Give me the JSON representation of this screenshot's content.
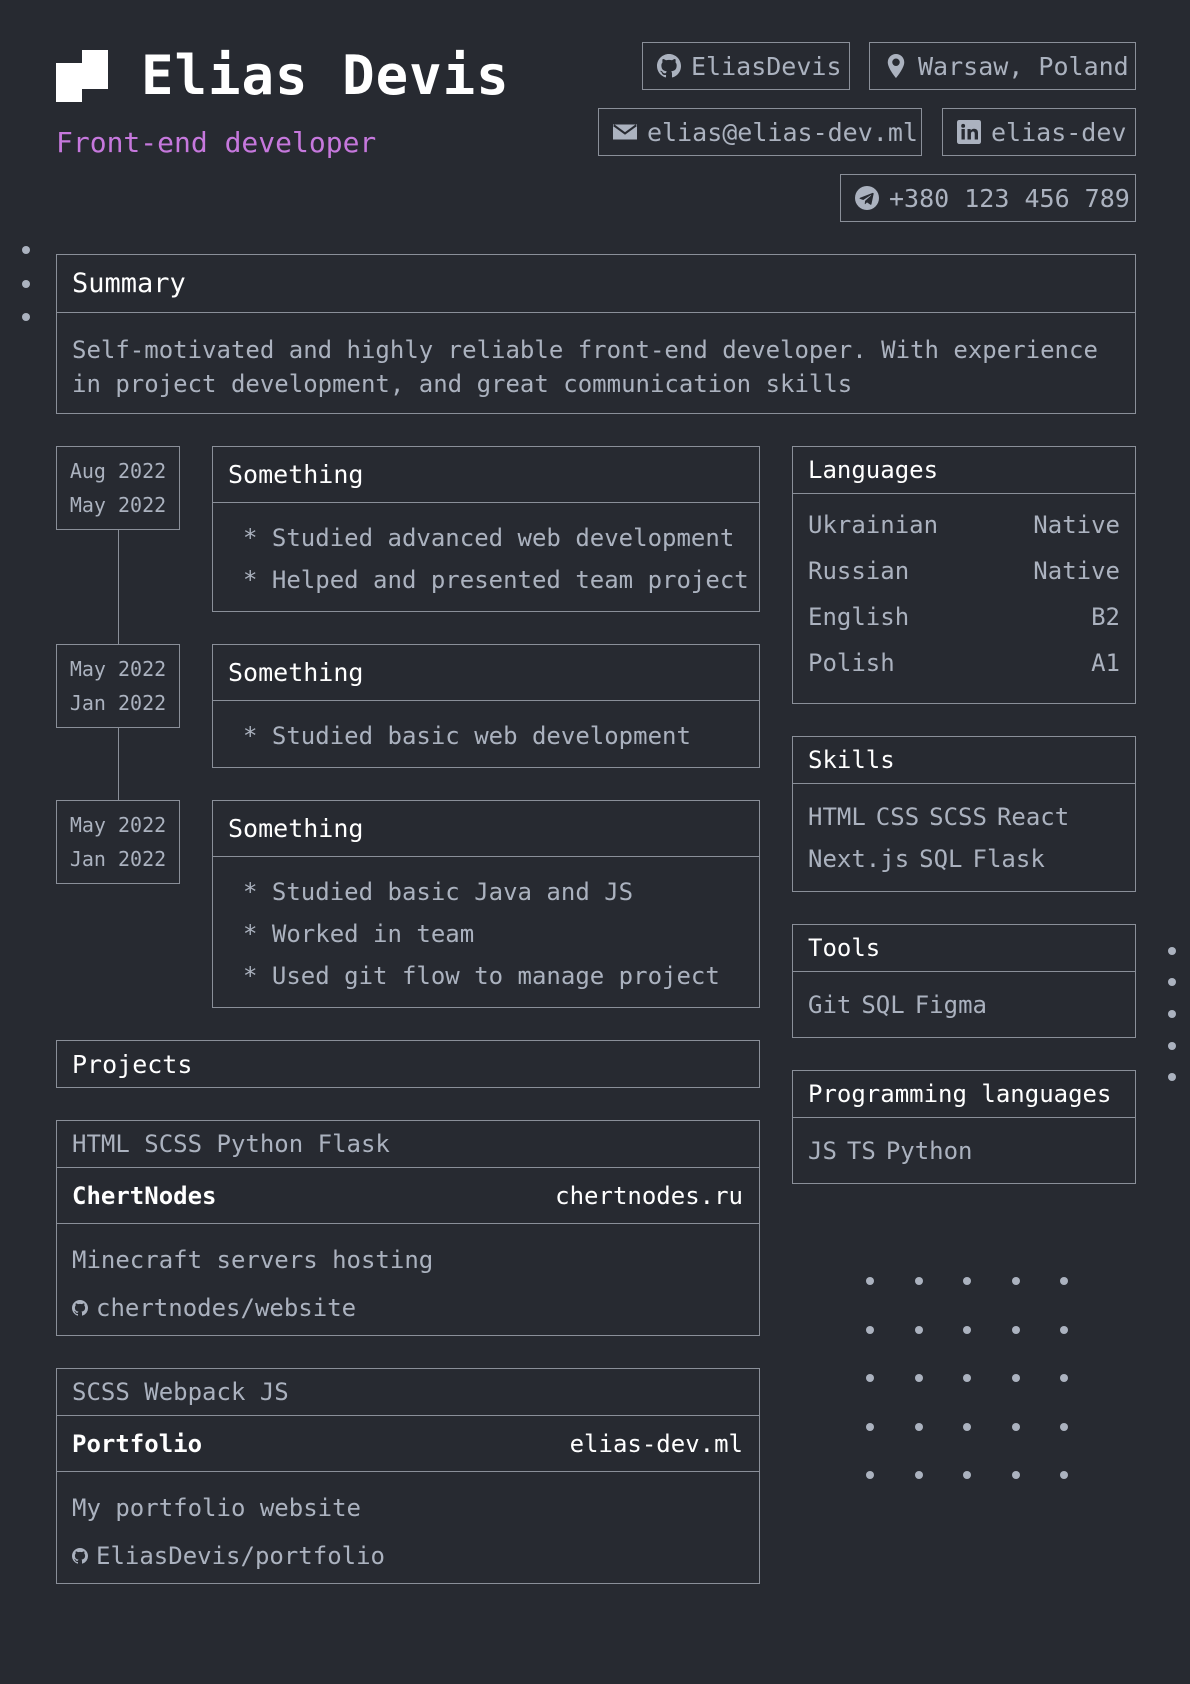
{
  "header": {
    "name": "Elias Devis",
    "role": "Front-end developer"
  },
  "contacts": {
    "github": {
      "icon": "github-icon",
      "text": "EliasDevis"
    },
    "location": {
      "icon": "map-pin-icon",
      "text": "Warsaw, Poland"
    },
    "email": {
      "icon": "envelope-icon",
      "text": "elias@elias-dev.ml"
    },
    "linkedin": {
      "icon": "linkedin-icon",
      "text": "elias-dev"
    },
    "telegram": {
      "icon": "telegram-icon",
      "text": "+380 123 456 789"
    }
  },
  "summary": {
    "title": "Summary",
    "line1": "Self-motivated and highly reliable front-end developer. With experience",
    "line2": "in project development, and great communication skills"
  },
  "experience": [
    {
      "date_end": "Aug 2022",
      "date_start": "May 2022",
      "title": "Something",
      "bullets": [
        "* Studied advanced web development",
        "* Helped and presented team project"
      ]
    },
    {
      "date_end": "May 2022",
      "date_start": "Jan 2022",
      "title": "Something",
      "bullets": [
        "* Studied basic web development"
      ]
    },
    {
      "date_end": "May 2022",
      "date_start": "Jan 2022",
      "title": "Something",
      "bullets": [
        "* Studied basic Java and JS",
        "* Worked in team",
        "* Used git flow to manage project"
      ]
    }
  ],
  "languages": {
    "title": "Languages",
    "items": [
      {
        "name": "Ukrainian",
        "level": "Native"
      },
      {
        "name": "Russian",
        "level": "Native"
      },
      {
        "name": "English",
        "level": "B2"
      },
      {
        "name": "Polish",
        "level": "A1"
      }
    ]
  },
  "skills": {
    "title": "Skills",
    "row1": [
      "HTML",
      "CSS",
      "SCSS",
      "React"
    ],
    "row2": [
      "Next.js",
      "SQL",
      "Flask"
    ]
  },
  "tools": {
    "title": "Tools",
    "items": [
      "Git",
      "SQL",
      "Figma"
    ]
  },
  "programming_languages": {
    "title": "Programming languages",
    "items": [
      "JS",
      "TS",
      "Python"
    ]
  },
  "projects": {
    "title": "Projects",
    "items": [
      {
        "tags": "HTML SCSS Python Flask",
        "name": "ChertNodes",
        "link": "chertnodes.ru",
        "description": "Minecraft servers hosting",
        "repo": "chertnodes/website"
      },
      {
        "tags": "SCSS Webpack JS",
        "name": "Portfolio",
        "link": "elias-dev.ml",
        "description": "My portfolio website",
        "repo": "EliasDevis/portfolio"
      }
    ]
  },
  "colors": {
    "background": "#272a31",
    "text": "#abb2bf",
    "accent": "#c678dd",
    "border": "#8a8f99"
  }
}
